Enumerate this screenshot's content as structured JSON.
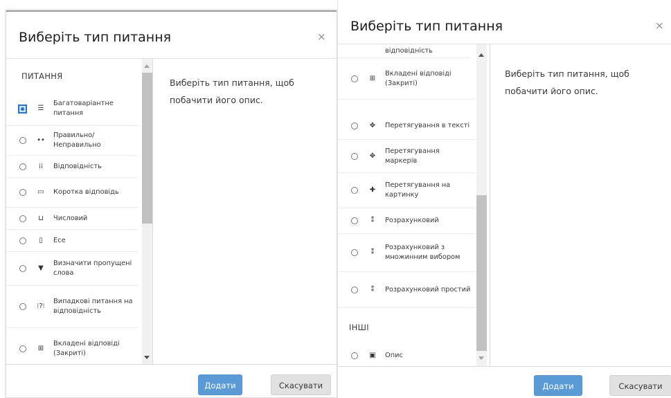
{
  "dialog_title": "Виберіть тип питання",
  "close_glyph": "×",
  "description": [
    "Виберіть тип питання, щоб",
    "побачити його опис."
  ],
  "sections": {
    "questions": "ПИТАННЯ",
    "other": "ІНШІ"
  },
  "left_options": [
    {
      "label": "Багатоваріантне питання",
      "icon": "list-icon",
      "glyph": "☰",
      "checked": true
    },
    {
      "label": "Правильно/ Неправильно",
      "icon": "two-dots-icon",
      "glyph": "••",
      "checked": false
    },
    {
      "label": "Відповідність",
      "icon": "match-grid-icon",
      "glyph": "⁞⁞",
      "checked": false
    },
    {
      "label": "Коротка відповідь",
      "icon": "short-answer-icon",
      "glyph": "▭",
      "checked": false
    },
    {
      "label": "Числовий",
      "icon": "numeric-icon",
      "glyph": "⊔",
      "checked": false
    },
    {
      "label": "Есе",
      "icon": "essay-icon",
      "glyph": "▯",
      "checked": false
    },
    {
      "label": "Визначити пропущені слова",
      "icon": "dropdown-icon",
      "glyph": "▼",
      "checked": false
    },
    {
      "label": "Випадкові питання на відповідність",
      "icon": "random-match-icon",
      "glyph": "⁝?⁝",
      "checked": false
    },
    {
      "label": "Вкладені відповіді (Закриті)",
      "icon": "embedded-answers-icon",
      "glyph": "⊞",
      "checked": false
    }
  ],
  "right_partial_top": "відповідність",
  "right_options": [
    {
      "label": "Вкладені відповіді (Закриті)",
      "icon": "embedded-answers-icon",
      "glyph": "⊞"
    },
    {
      "label": "Перетягування в тексті",
      "icon": "drag-text-icon",
      "glyph": "✥"
    },
    {
      "label": "Перетягування маркерів",
      "icon": "drag-markers-icon",
      "glyph": "✥"
    },
    {
      "label": "Перетягування на картинку",
      "icon": "drag-image-icon",
      "glyph": "✚"
    },
    {
      "label": "Розрахунковий",
      "icon": "calculated-icon",
      "glyph": "⁑"
    },
    {
      "label": "Розрахунковий з множинним вибором",
      "icon": "calculated-multi-icon",
      "glyph": "⁑"
    },
    {
      "label": "Розрахунковий простий",
      "icon": "calculated-simple-icon",
      "glyph": "⁑"
    }
  ],
  "other_options": [
    {
      "label": "Опис",
      "icon": "description-icon",
      "glyph": "▣"
    }
  ],
  "buttons": {
    "add": "Додати",
    "cancel": "Скасувати"
  },
  "colors": {
    "primary": "#5b9bd5",
    "checked": "#2c73c6"
  }
}
